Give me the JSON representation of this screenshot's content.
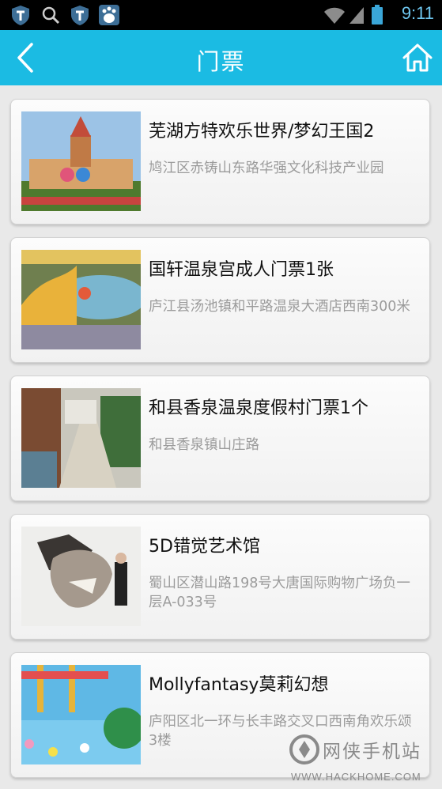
{
  "status_bar": {
    "time": "9:11"
  },
  "header": {
    "title": "门票"
  },
  "items": [
    {
      "title": "芜湖方特欢乐世界/梦幻王国2",
      "address": "鸠江区赤铸山东路华强文化科技产业园"
    },
    {
      "title": "国轩温泉宫成人门票1张",
      "address": "庐江县汤池镇和平路温泉大酒店西南300米"
    },
    {
      "title": "和县香泉温泉度假村门票1个",
      "address": "和县香泉镇山庄路"
    },
    {
      "title": "5D错觉艺术馆",
      "address": "蜀山区潜山路198号大唐国际购物广场负一层A-033号"
    },
    {
      "title": "Mollyfantasy莫莉幻想",
      "address": "庐阳区北一环与长丰路交叉口西南角欢乐颂3楼"
    }
  ],
  "watermark": {
    "text": "网侠手机站",
    "url": "WWW.HACKHOME.COM"
  },
  "colors": {
    "header": "#1bbbe3",
    "title_text": "#111111",
    "address_text": "#9b9b9b"
  }
}
